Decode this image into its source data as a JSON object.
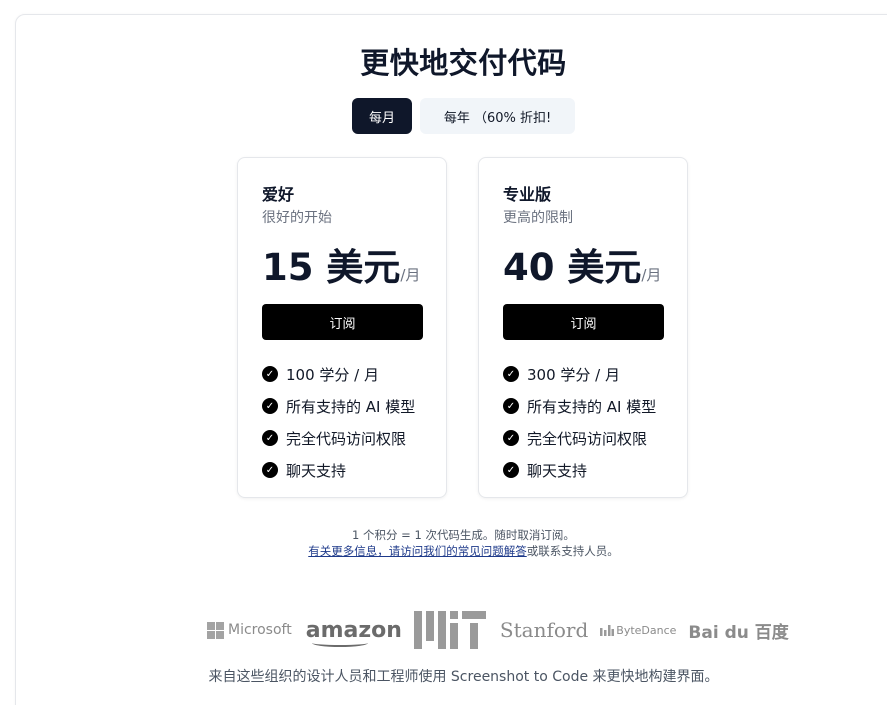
{
  "header": {
    "title": "更快地交付代码"
  },
  "billing_toggle": {
    "monthly_label": "每月",
    "yearly_label": "每年 （60% 折扣!"
  },
  "plans": [
    {
      "name": "爱好",
      "subtitle": "很好的开始",
      "price": "15 美元",
      "per": "/月",
      "button": "订阅",
      "features": [
        "100 学分 / 月",
        "所有支持的 AI 模型",
        "完全代码访问权限",
        "聊天支持"
      ]
    },
    {
      "name": "专业版",
      "subtitle": "更高的限制",
      "price": "40 美元",
      "per": "/月",
      "button": "订阅",
      "features": [
        "300 学分 / 月",
        "所有支持的 AI 模型",
        "完全代码访问权限",
        "聊天支持"
      ]
    }
  ],
  "notes": {
    "line1": "1 个积分 = 1 次代码生成。随时取消订阅。",
    "link": "有关更多信息，请访问我们的常见问题解答",
    "line2_suffix": "或联系支持人员。"
  },
  "logos": {
    "microsoft": "Microsoft",
    "amazon": "amazon",
    "stanford": "Stanford",
    "bytedance": "ByteDance",
    "baidu": "Bai du 百度"
  },
  "footer": {
    "text": "来自这些组织的设计人员和工程师使用 Screenshot to Code 来更快地构建界面。"
  }
}
